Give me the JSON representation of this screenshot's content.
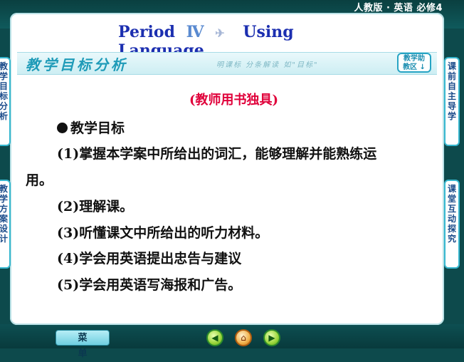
{
  "header": {
    "book_label": "人教版 · 英语  必修4"
  },
  "title": {
    "period": "Period",
    "numeral": "Ⅳ",
    "topic": "Using Language"
  },
  "section": {
    "title": "教学目标分析",
    "subtitle": "明课标  分条解读  如\"目标\"",
    "assist_button": "教学助\n教区 ↓"
  },
  "content": {
    "exclusive_note": "(教师用书独具)",
    "goals_heading": "教学目标",
    "goals": [
      "(1)掌握本学案中所给出的词汇，能够理解并能熟练运",
      "用。",
      "(2)理解课。",
      "(3)听懂课文中所给出的听力材料。",
      "(4)学会用英语提出忠告与建议",
      "(5)学会用英语写海报和广告。"
    ]
  },
  "side_tabs": {
    "left_top": "教学目标分析",
    "left_bottom": "教学方案设计",
    "right_top": "课前自主导学",
    "right_bottom": "课堂互动探究"
  },
  "footer": {
    "menu_label": "菜单",
    "prev_icon": "arrow-left-icon",
    "home_icon": "home-icon",
    "next_icon": "arrow-right-icon"
  },
  "colors": {
    "background": "#0d4a4c",
    "title_blue": "#1c2fb0",
    "exclusive_red": "#e0003a",
    "tab_border": "#36b7cf"
  }
}
